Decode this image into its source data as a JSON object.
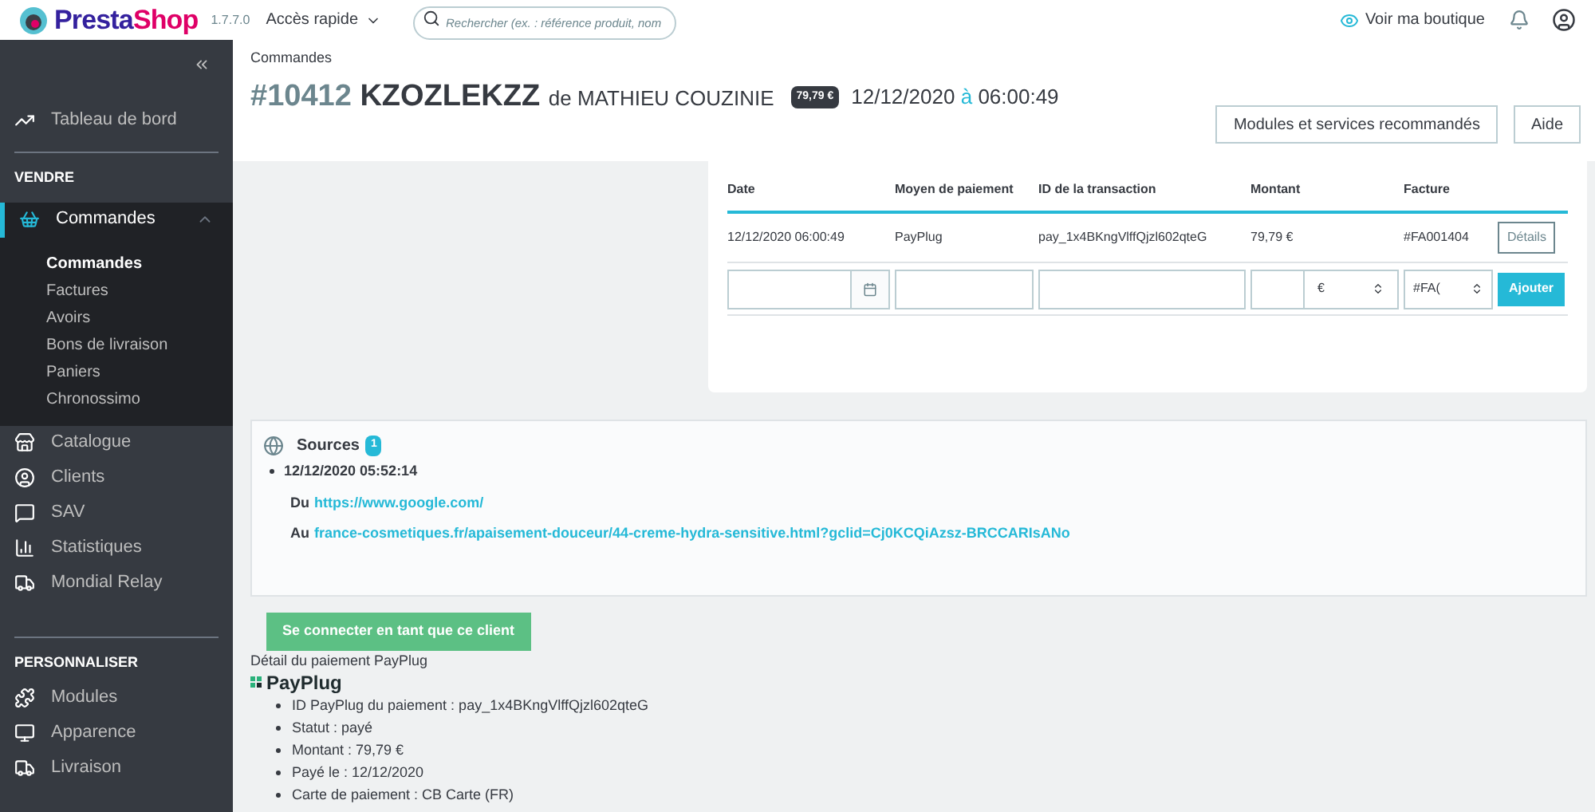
{
  "topbar": {
    "logo": "PrestaShop",
    "version": "1.7.7.0",
    "quick_access": "Accès rapide",
    "search": {
      "placeholder": "Rechercher (ex. : référence produit, nom"
    },
    "view_shop": "Voir ma boutique"
  },
  "sidebar": {
    "dashboard": {
      "label": "Tableau de bord",
      "selected": false
    },
    "sections": [
      {
        "title": "VENDRE",
        "items": [
          {
            "label": "Commandes",
            "selected": true,
            "expanded": true,
            "children": [
              {
                "label": "Commandes",
                "selected": true
              },
              {
                "label": "Factures",
                "selected": false
              },
              {
                "label": "Avoirs",
                "selected": false
              },
              {
                "label": "Bons de livraison",
                "selected": false
              },
              {
                "label": "Paniers",
                "selected": false
              },
              {
                "label": "Chronossimo",
                "selected": false
              }
            ]
          },
          {
            "label": "Catalogue",
            "selected": false
          },
          {
            "label": "Clients",
            "selected": false
          },
          {
            "label": "SAV",
            "selected": false
          },
          {
            "label": "Statistiques",
            "selected": false
          },
          {
            "label": "Mondial Relay",
            "selected": false
          }
        ]
      },
      {
        "title": "PERSONNALISER",
        "items": [
          {
            "label": "Modules",
            "selected": false
          },
          {
            "label": "Apparence",
            "selected": false
          },
          {
            "label": "Livraison",
            "selected": false
          }
        ]
      }
    ]
  },
  "header": {
    "breadcrumb": "Commandes",
    "order_number": "#10412",
    "reference": "KZOZLEKZZ",
    "customer_prefix": "de",
    "customer": "MATHIEU COUZINIE",
    "total_badge": "79,79 €",
    "date": "12/12/2020",
    "time_prefix": "à",
    "time": "06:00:49",
    "buttons": [
      "Modules et services recommandés",
      "Aide"
    ]
  },
  "payments": {
    "columns": [
      "Date",
      "Moyen de paiement",
      "ID de la transaction",
      "Montant",
      "Facture"
    ],
    "rows": [
      {
        "date": "12/12/2020 06:00:49",
        "method": "PayPlug",
        "transaction": "pay_1x4BKngVlffQjzl602qteG",
        "amount": "79,79 €",
        "invoice": "#FA001404",
        "action": "Détails"
      }
    ],
    "form": {
      "currency": "€",
      "invoice": "#FA(",
      "submit": "Ajouter"
    }
  },
  "sources": {
    "title": "Sources",
    "count": "1",
    "items": [
      {
        "date": "12/12/2020 05:52:14",
        "from_label": "Du",
        "from": "https://www.google.com/",
        "to_label": "Au",
        "to": "france-cosmetiques.fr/apaisement-douceur/44-creme-hydra-sensitive.html?gclid=Cj0KCQiAzsz-BRCCARIsANo"
      }
    ]
  },
  "login_button": "Se connecter en tant que ce client",
  "payplug": {
    "heading": "Détail du paiement PayPlug",
    "logo": "PayPlug",
    "details": [
      "ID PayPlug du paiement : pay_1x4BKngVlffQjzl602qteG",
      "Statut : payé",
      "Montant : 79,79 €",
      "Payé le : 12/12/2020",
      "Carte de paiement : CB Carte (FR)"
    ]
  }
}
